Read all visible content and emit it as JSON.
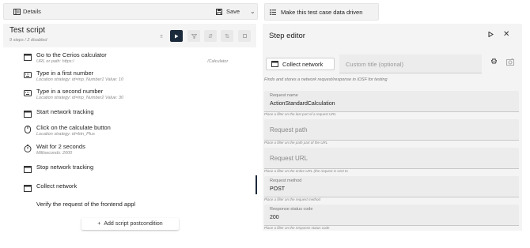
{
  "topbar": {
    "details_label": "Details",
    "save_label": "Save"
  },
  "datadriven_label": "Make this test case data driven",
  "script": {
    "title": "Test script",
    "subtitle": "9 steps / 2 disabled",
    "steps": [
      {
        "title": "Go to the Cerios calculator",
        "sub": "URL or path: https:/",
        "right": "/Calculator"
      },
      {
        "title": "Type in a first number",
        "sub": "Location strategy: id=inp_Number1 Value: 10"
      },
      {
        "title": "Type in a second number",
        "sub": "Location strategy: id=inp_Number2 Value: 30"
      },
      {
        "title": "Start network tracking"
      },
      {
        "title": "Click on the calculate button",
        "sub": "Location strategy: id=btn_Plus"
      },
      {
        "title": "Wait for 2 seconds",
        "sub": "Milliseconds: 2000"
      },
      {
        "title": "Stop network tracking"
      },
      {
        "title": "Collect network"
      },
      {
        "title": "Verify the request of the frontend appl"
      }
    ],
    "add_postcondition": "Add script postcondition"
  },
  "editor": {
    "title": "Step editor",
    "collect_button": "Collect network",
    "custom_title_placeholder": "Custom title (optional)",
    "description": "Finds and stores a network request/response in iOSF for testing",
    "fields": [
      {
        "label": "Request name",
        "value": "ActionStandardCalculation",
        "hint": "Place a filter on the last part of a request URL"
      },
      {
        "label": "",
        "placeholder": "Request path",
        "hint": "Place a filter on the path part of the URL"
      },
      {
        "label": "",
        "placeholder": "Request URL",
        "hint": "Place a filter on the entire URL (the request is sent to"
      },
      {
        "label": "Request method",
        "value": "POST",
        "hint": "Place a filter on the request method"
      },
      {
        "label": "Response status code",
        "value": "200",
        "hint": "Place a filter on the response status code"
      }
    ]
  }
}
